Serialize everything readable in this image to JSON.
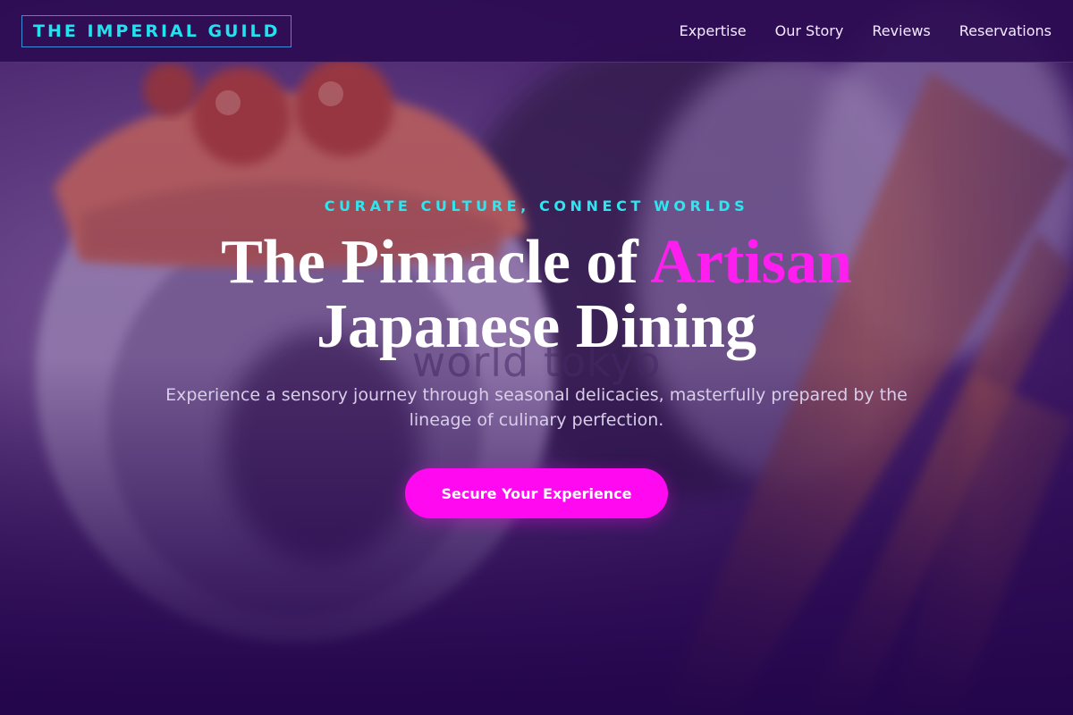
{
  "nav": {
    "logo": "THE IMPERIAL GUILD",
    "links": [
      "Expertise",
      "Our Story",
      "Reviews",
      "Reservations"
    ]
  },
  "hero": {
    "eyebrow": "CURATE CULTURE, CONNECT WORLDS",
    "headline_part1": "The Pinnacle of ",
    "headline_accent": "Artisan",
    "headline_line2": "Japanese Dining",
    "watermark": "world tokyo",
    "subtext": "Experience a sensory journey through seasonal delicacies, masterfully prepared by the lineage of culinary perfection.",
    "cta_label": "Secure Your Experience"
  },
  "colors": {
    "accent_cyan": "#22e2f0",
    "accent_magenta": "#ff0af0",
    "navbar_bg": "#2d0c52",
    "hero_base": "#2a0a4a"
  }
}
